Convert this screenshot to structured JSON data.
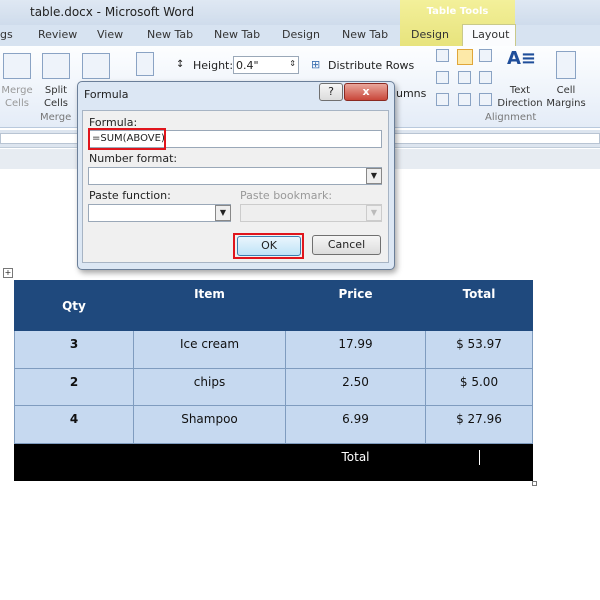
{
  "window": {
    "title": "table.docx - Microsoft Word",
    "context_tab": "Table Tools"
  },
  "tabs": [
    "gs",
    "Review",
    "View",
    "New Tab",
    "New Tab",
    "Design",
    "New Tab",
    "Design",
    "Layout"
  ],
  "ribbon": {
    "merge_cells": "Merge Cells",
    "split_cells": "Split Cells",
    "merge_group": "Merge",
    "height_label": "Height:",
    "height_value": "0.4\"",
    "distribute_rows": "Distribute Rows",
    "columns_partial": "umns",
    "text_direction": "Text Direction",
    "cell_margins": "Cell Margins",
    "alignment_group": "Alignment"
  },
  "dialog": {
    "title": "Formula",
    "formula_label": "Formula:",
    "formula_value": "=SUM(ABOVE)",
    "number_format_label": "Number format:",
    "number_format_value": "",
    "paste_function_label": "Paste function:",
    "paste_bookmark_label": "Paste bookmark:",
    "ok": "OK",
    "cancel": "Cancel",
    "help": "?",
    "close": "x"
  },
  "table": {
    "headers": [
      "Qty",
      "Item",
      "Price",
      "Total"
    ],
    "rows": [
      [
        "3",
        "Ice cream",
        "17.99",
        "$  53.97"
      ],
      [
        "2",
        "chips",
        "2.50",
        "$  5.00"
      ],
      [
        "4",
        "Shampoo",
        "6.99",
        "$  27.96"
      ]
    ],
    "total_label": "Total"
  },
  "colors": {
    "header": "#1f497d",
    "body": "#c6d9f0",
    "highlight": "#e0151c"
  }
}
